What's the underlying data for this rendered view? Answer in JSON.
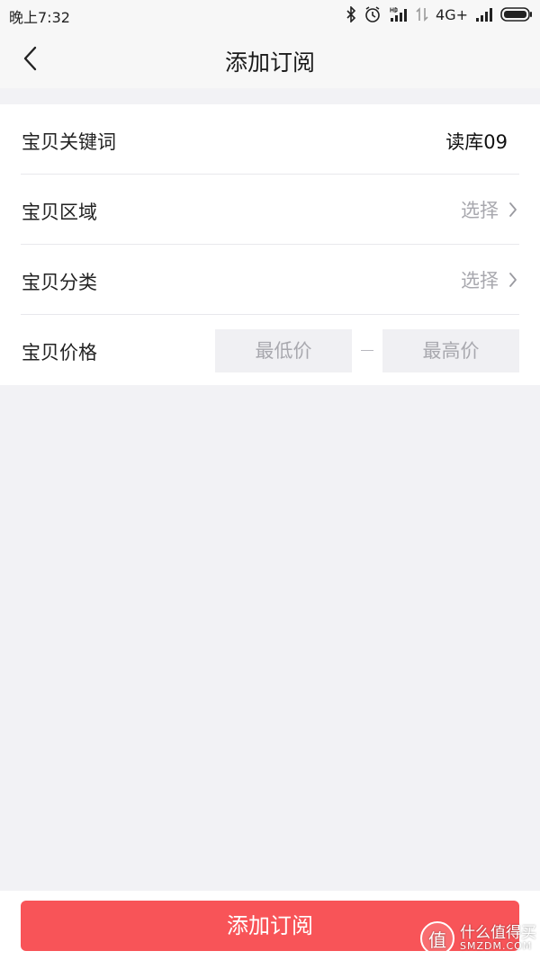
{
  "status_bar": {
    "time": "晚上7:32",
    "network": "4G+",
    "icons": [
      "bluetooth-icon",
      "alarm-icon",
      "hd-signal-icon",
      "data-arrows-icon",
      "signal-icon",
      "battery-icon"
    ]
  },
  "nav": {
    "title": "添加订阅",
    "back_icon": "chevron-left-icon"
  },
  "form": {
    "keyword": {
      "label": "宝贝关键词",
      "value": "读库09"
    },
    "region": {
      "label": "宝贝区域",
      "placeholder": "选择"
    },
    "category": {
      "label": "宝贝分类",
      "placeholder": "选择"
    },
    "price": {
      "label": "宝贝价格",
      "min_placeholder": "最低价",
      "max_placeholder": "最高价",
      "min_value": "",
      "max_value": ""
    }
  },
  "submit": {
    "label": "添加订阅"
  },
  "watermark": {
    "badge": "值",
    "text_cn": "什么值得买",
    "text_en": "SMZDM.COM"
  },
  "colors": {
    "accent": "#f85458",
    "background": "#f2f2f5",
    "placeholder": "#a8a8ae"
  }
}
